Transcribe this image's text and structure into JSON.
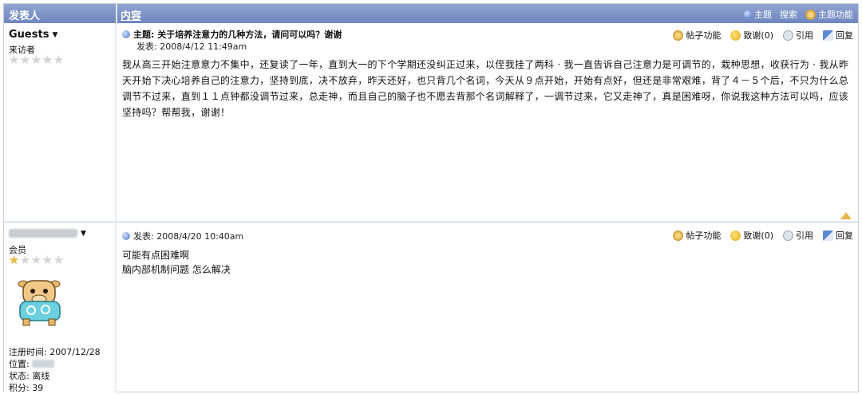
{
  "header": {
    "author_col": "发表人",
    "content_col": "内容",
    "tools": [
      "主题",
      "搜索",
      "主题功能"
    ]
  },
  "posts": [
    {
      "author": "Guests",
      "role": "来访者",
      "stars": "0 of 5",
      "subject": "主题: 关于培养注意力的几种方法，请问可以吗？谢谢",
      "time": "发表:  2008/4/12 11:49am",
      "actions": [
        "帖子功能",
        "致谢(0)",
        "引用",
        "回复"
      ],
      "body": "我从高三开始注意意力不集中，还复读了一年，直到大一的下个学期还没纠正过来，以侄我挂了两科 · 我一直告诉自己注意力是可调节的，栽种思想，收获行为 · 我从昨天开始下决心培养自己的注意力，坚持到底，决不放弃，昨天还好，也只背几个名词，今天从９点开始，开始有点好，但还是非常艰难，背了４－５个后，不只为什么总调节不过来，直到１１点钟都没调节过来，总走神，而且自己的脑子也不愿去背那个名词解释了，一调节过来，它又走神了，真是困难呀，你说我这种方法可以吗，应该坚持吗？帮帮我，谢谢！"
    },
    {
      "author": "",
      "role": "会员",
      "stars": "1 of 5",
      "time": "发表:  2008/4/20 10:40am",
      "actions": [
        "帖子功能",
        "致谢(0)",
        "引用",
        "回复"
      ],
      "body_lines": [
        "可能有点困难啊",
        "脑内部机制问题  怎么解决"
      ],
      "meta": {
        "reg": "注册时间: 2007/12/28",
        "location": "位置:",
        "status": "状态: 离线",
        "points": "积分: 39"
      }
    }
  ]
}
